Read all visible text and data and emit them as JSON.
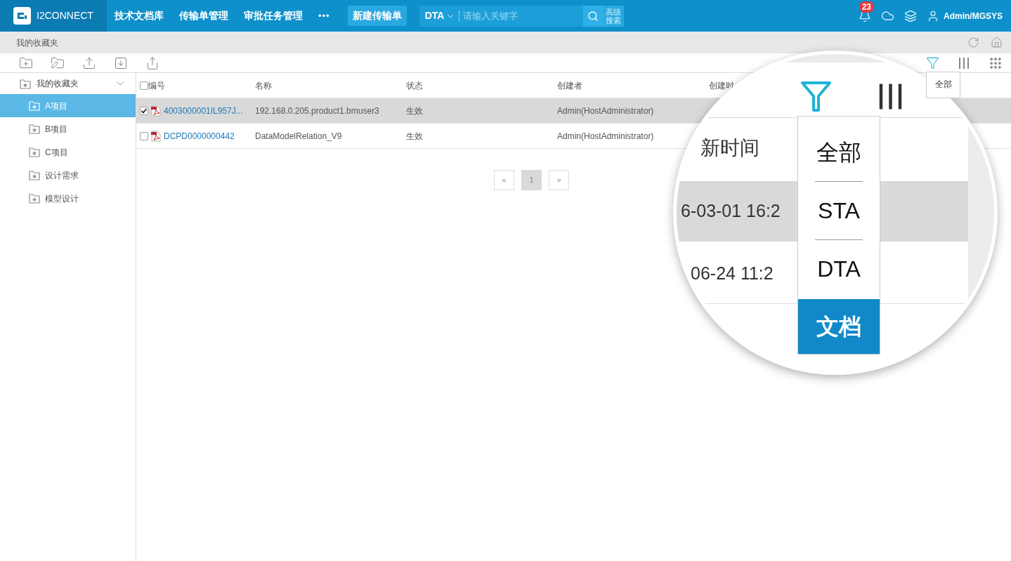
{
  "topbar": {
    "logo_text": "I2CONNECT",
    "nav": [
      {
        "label": "技术文档库"
      },
      {
        "label": "传输单管理"
      },
      {
        "label": "审批任务管理"
      }
    ],
    "more": "•••",
    "new_button": "新建传输单",
    "search": {
      "scope": "DTA",
      "placeholder": "请输入关键字"
    },
    "advanced": [
      "高级",
      "搜索"
    ],
    "notifications": "23",
    "user": "Admin/MGSYS"
  },
  "breadcrumb": "我的收藏夹",
  "sidebar": {
    "root": {
      "label": "我的收藏夹",
      "expanded": true,
      "children": [
        {
          "label": "A项目",
          "selected": true
        },
        {
          "label": "B项目",
          "selected": false
        },
        {
          "label": "C项目",
          "selected": false
        },
        {
          "label": "设计需求",
          "selected": false
        },
        {
          "label": "模型设计",
          "selected": false
        }
      ]
    }
  },
  "table": {
    "columns": [
      "编号",
      "名称",
      "状态",
      "创建者",
      "创建时"
    ],
    "all_checked": false,
    "rows": [
      {
        "checked": true,
        "selected": true,
        "id": "4003000001IL957J...",
        "name": "192.168.0.205.product1.bmuser3",
        "status": "生效",
        "creator": "Admin(HostAdministrator)"
      },
      {
        "checked": false,
        "selected": false,
        "id": "DCPD0000000442",
        "name": "DataModelRelation_V9",
        "status": "生效",
        "creator": "Admin(HostAdministrator)"
      }
    ]
  },
  "pagination": {
    "prev": "«",
    "pages": [
      {
        "label": "1",
        "selected": true
      }
    ],
    "next": "»"
  },
  "filter_popup": {
    "label": "全部"
  },
  "magnifier": {
    "column_header": "新时间",
    "rows": [
      {
        "date": "6-03-01 16:2",
        "selected": true
      },
      {
        "date": "06-24 11:2",
        "selected": false
      }
    ],
    "menu": [
      {
        "label": "全部",
        "selected": false
      },
      {
        "label": "STA",
        "selected": false
      },
      {
        "label": "DTA",
        "selected": false
      },
      {
        "label": "文档",
        "selected": true
      }
    ]
  }
}
